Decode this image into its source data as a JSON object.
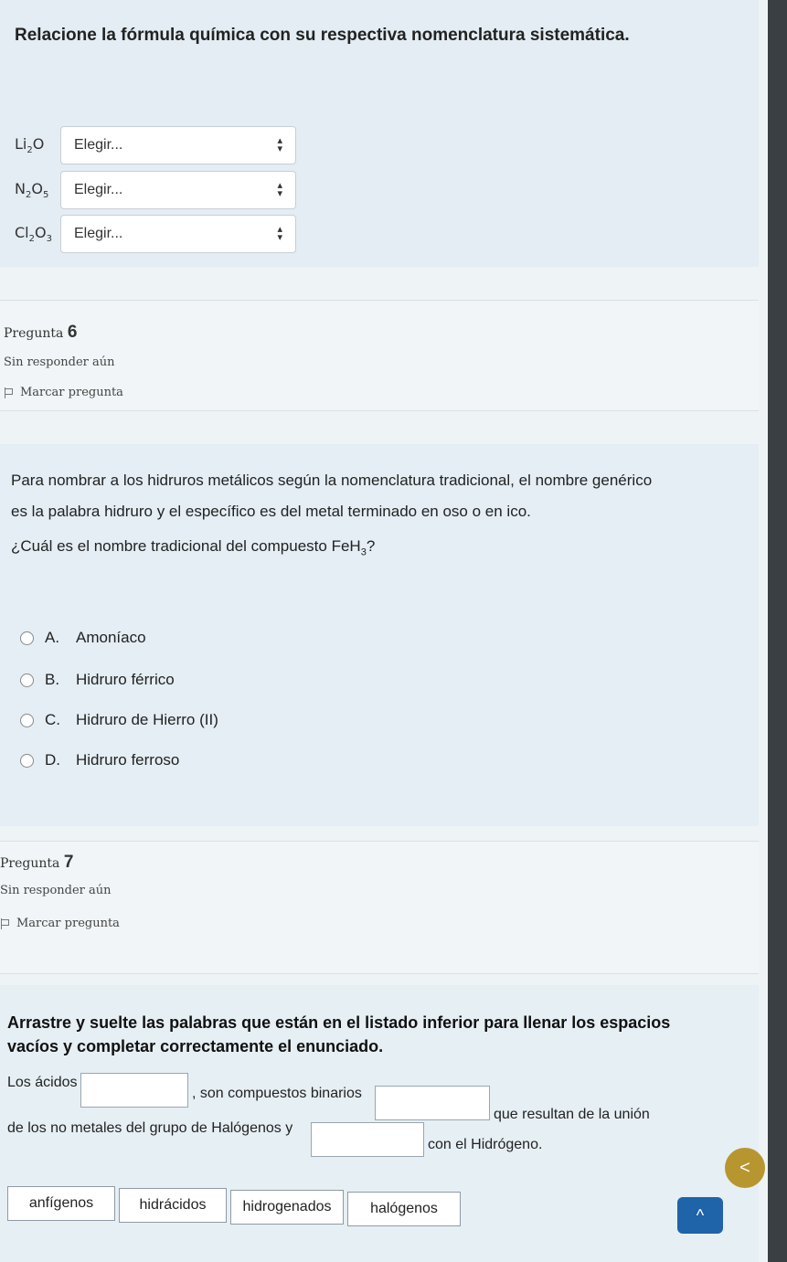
{
  "q5": {
    "title": "Relacione la fórmula química con su respectiva nomenclatura sistemática.",
    "rows": [
      {
        "formula_base": "Li",
        "sub1": "2",
        "mid": "O",
        "sub2": "",
        "select": "Elegir..."
      },
      {
        "formula_base": "N",
        "sub1": "2",
        "mid": "O",
        "sub2": "5",
        "select": "Elegir..."
      },
      {
        "formula_base": "Cl",
        "sub1": "2",
        "mid": "O",
        "sub2": "3",
        "select": "Elegir..."
      }
    ]
  },
  "q6": {
    "label": "Pregunta",
    "number": "6",
    "status": "Sin responder aún",
    "flag": "Marcar pregunta",
    "text1": "Para nombrar a los hidruros metálicos según la nomenclatura tradicional, el nombre genérico",
    "text2": "es la palabra hidruro y el específico es del metal terminado en oso o en ico.",
    "question_pre": "¿Cuál es el nombre tradicional del compuesto FeH",
    "question_sub": "3",
    "question_post": "?",
    "options": [
      {
        "letter": "A.",
        "text": "Amoníaco"
      },
      {
        "letter": "B.",
        "text": "Hidruro férrico"
      },
      {
        "letter": "C.",
        "text": "Hidruro de Hierro (II)"
      },
      {
        "letter": "D.",
        "text": "Hidruro ferroso"
      }
    ]
  },
  "q7": {
    "label": "Pregunta",
    "number": "7",
    "status": "Sin responder aún",
    "flag": "Marcar pregunta",
    "instructions": "Arrastre y suelte las palabras que están en el listado inferior para llenar los espacios vacíos y completar correctamente el enunciado.",
    "seg1": "Los ácidos",
    "seg2": ", son compuestos binarios",
    "seg3": "que resultan de la unión",
    "seg4": "de los no metales del grupo de Halógenos y",
    "seg5": "con el Hidrógeno.",
    "chips": [
      "anfígenos",
      "hidrácidos",
      "hidrogenados",
      "halógenos"
    ]
  },
  "nav": {
    "back": "<",
    "top": "^"
  }
}
